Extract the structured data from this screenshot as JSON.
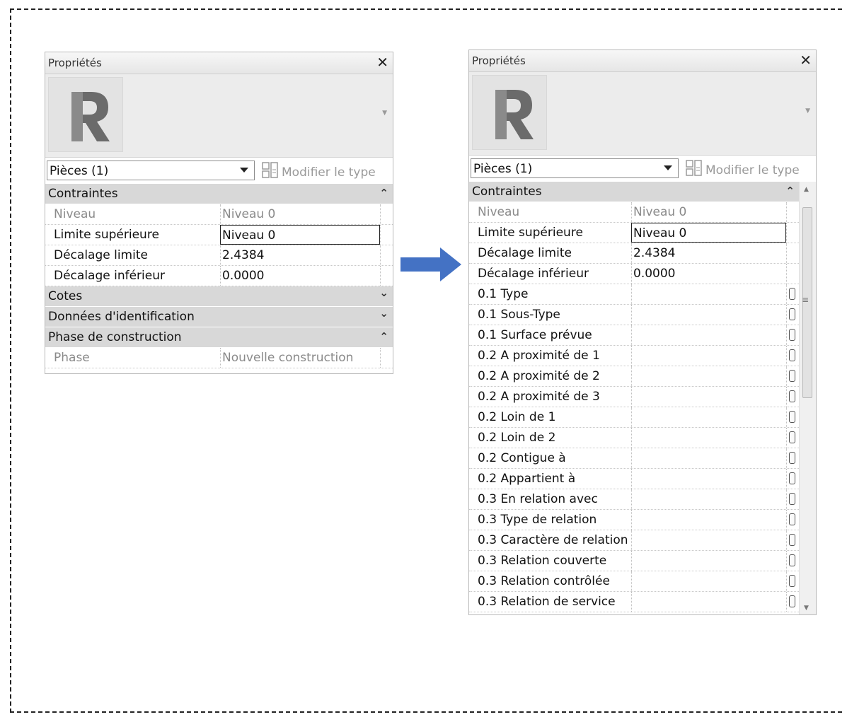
{
  "left_panel": {
    "title": "Propriétés",
    "type_selector": "Pièces (1)",
    "edit_type": "Modifier le type",
    "groups": [
      {
        "label": "Contraintes",
        "state": "expanded",
        "rows": [
          {
            "name": "Niveau",
            "value": "Niveau 0",
            "style": "dim"
          },
          {
            "name": "Limite supérieure",
            "value": "Niveau 0",
            "style": "editing"
          },
          {
            "name": "Décalage limite",
            "value": "2.4384",
            "style": "normal"
          },
          {
            "name": "Décalage inférieur",
            "value": "0.0000",
            "style": "normal"
          }
        ]
      },
      {
        "label": "Cotes",
        "state": "collapsed",
        "rows": []
      },
      {
        "label": "Données d'identification",
        "state": "collapsed",
        "rows": []
      },
      {
        "label": "Phase de construction",
        "state": "expanded",
        "rows": [
          {
            "name": "Phase",
            "value": "Nouvelle construction",
            "style": "dim"
          }
        ]
      }
    ]
  },
  "right_panel": {
    "title": "Propriétés",
    "type_selector": "Pièces (1)",
    "edit_type": "Modifier le type",
    "group_label": "Contraintes",
    "rows": [
      {
        "name": "Niveau",
        "value": "Niveau 0",
        "style": "dim"
      },
      {
        "name": "Limite supérieure",
        "value": "Niveau 0",
        "style": "editing"
      },
      {
        "name": "Décalage limite",
        "value": "2.4384",
        "style": "normal"
      },
      {
        "name": "Décalage inférieur",
        "value": "0.0000",
        "style": "normal"
      },
      {
        "name": "0.1 Type",
        "value": "",
        "style": "custom"
      },
      {
        "name": "0.1 Sous-Type",
        "value": "",
        "style": "custom"
      },
      {
        "name": "0.1 Surface prévue",
        "value": "",
        "style": "custom"
      },
      {
        "name": "0.2 A proximité de 1",
        "value": "",
        "style": "custom"
      },
      {
        "name": "0.2 A proximité de 2",
        "value": "",
        "style": "custom"
      },
      {
        "name": "0.2 A proximité de 3",
        "value": "",
        "style": "custom"
      },
      {
        "name": "0.2 Loin de 1",
        "value": "",
        "style": "custom"
      },
      {
        "name": "0.2 Loin de 2",
        "value": "",
        "style": "custom"
      },
      {
        "name": "0.2 Contigue à",
        "value": "",
        "style": "custom"
      },
      {
        "name": "0.2 Appartient à",
        "value": "",
        "style": "custom"
      },
      {
        "name": "0.3 En relation avec",
        "value": "",
        "style": "custom"
      },
      {
        "name": "0.3 Type de relation",
        "value": "",
        "style": "custom"
      },
      {
        "name": "0.3 Caractère de relation",
        "value": "",
        "style": "custom"
      },
      {
        "name": "0.3 Relation couverte",
        "value": "",
        "style": "custom"
      },
      {
        "name": "0.3 Relation contrôlée",
        "value": "",
        "style": "custom"
      },
      {
        "name": "0.3 Relation de service",
        "value": "",
        "style": "custom"
      }
    ]
  },
  "colors": {
    "arrow": "#4472c4",
    "group_bg": "#d8d8d8",
    "dim_text": "#8a8a8a"
  }
}
